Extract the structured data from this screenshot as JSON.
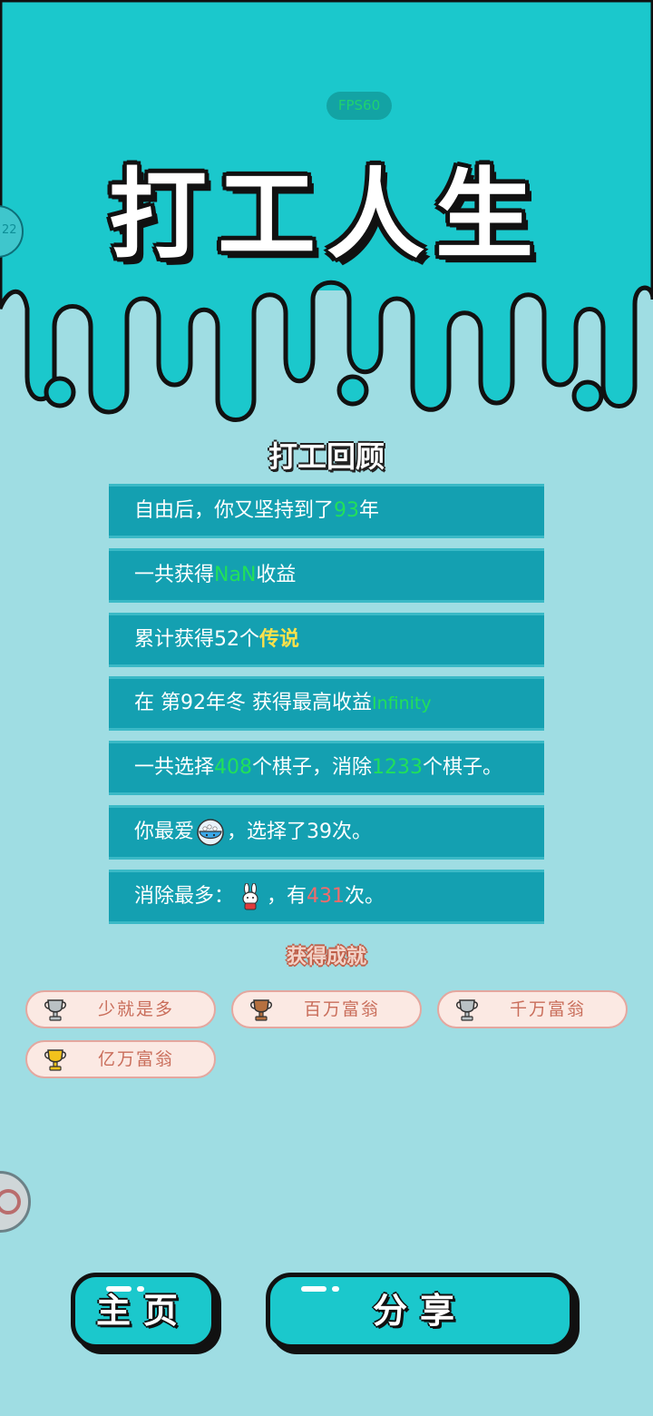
{
  "app": {
    "fps": "FPS60",
    "side_top_text": "22"
  },
  "title": "打工人生",
  "review": {
    "title": "打工回顾",
    "rows": [
      {
        "pre": "自由后，你又坚持到了",
        "value": "93",
        "post": "年"
      },
      {
        "pre": "一共获得",
        "value": "NaN",
        "post": "收益"
      },
      {
        "pre": "累计获得52个",
        "value": "传说",
        "post": ""
      },
      {
        "pre": "在 第92年冬 获得最高收益",
        "value": "Infinity",
        "post": ""
      },
      {
        "pre": "一共选择",
        "value": "408",
        "mid": "个棋子，消除",
        "value2": "1233",
        "post": "个棋子。"
      },
      {
        "pre": "你最爱",
        "icon": "rice-bowl-icon",
        "post": "，选择了39次。"
      },
      {
        "pre": "消除最多：",
        "icon": "rabbit-icon",
        "mid": "，有",
        "value": "431",
        "post": "次。"
      }
    ]
  },
  "achievements": {
    "title": "获得成就",
    "items": [
      {
        "label": "少就是多",
        "trophy": "silver-trophy-icon",
        "color": "#b9c1c4"
      },
      {
        "label": "百万富翁",
        "trophy": "bronze-trophy-icon",
        "color": "#b5703f"
      },
      {
        "label": "千万富翁",
        "trophy": "silver-trophy-icon",
        "color": "#b9c1c4"
      },
      {
        "label": "亿万富翁",
        "trophy": "gold-trophy-icon",
        "color": "#f2c21c"
      }
    ]
  },
  "buttons": {
    "home": "主页",
    "share": "分享"
  },
  "colors": {
    "accent": "#1bc8cc",
    "background": "#9fdde3",
    "row": "#14a0b1",
    "highlight_green": "#21e05a",
    "highlight_gold": "#ffe14a",
    "highlight_red": "#f26b6b"
  }
}
